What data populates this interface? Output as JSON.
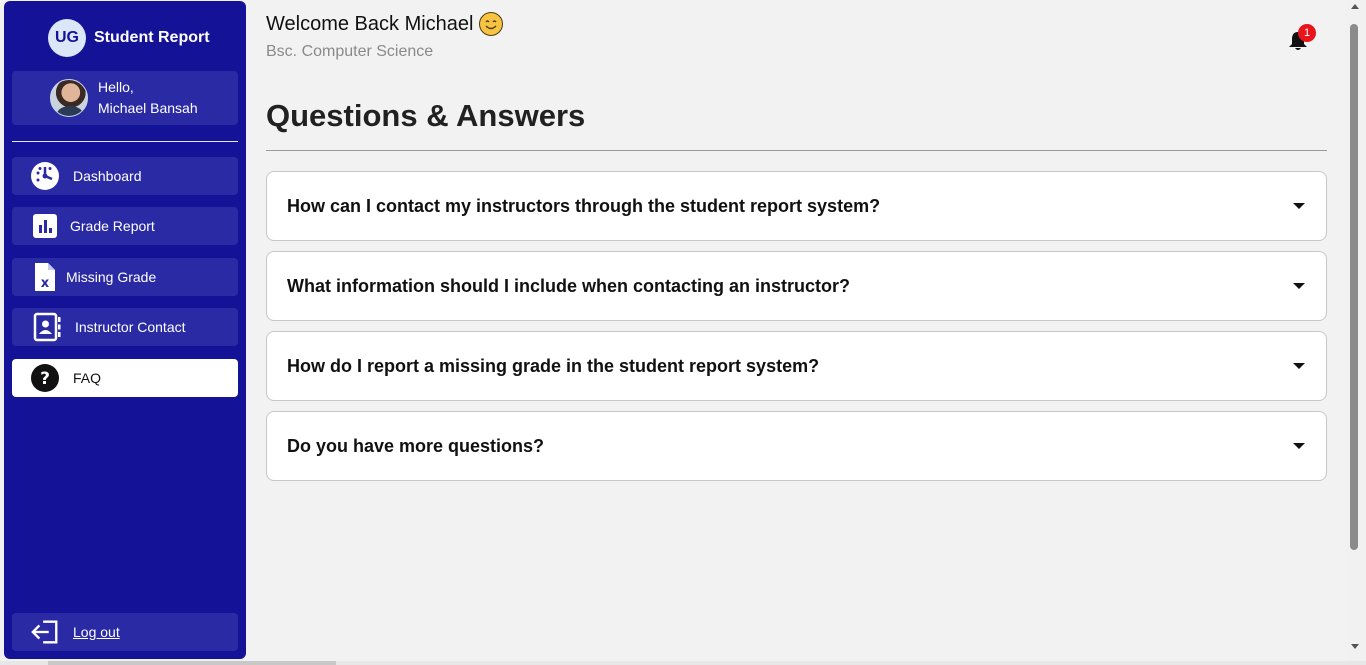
{
  "brand": {
    "badge": "UG",
    "name": "Student Report"
  },
  "user": {
    "greeting": "Hello,",
    "name": "Michael Bansah"
  },
  "nav": [
    {
      "label": "Dashboard",
      "icon": "dashboard-gauge-icon"
    },
    {
      "label": "Grade Report",
      "icon": "bar-chart-icon"
    },
    {
      "label": "Missing Grade",
      "icon": "file-x-icon"
    },
    {
      "label": "Instructor Contact",
      "icon": "contact-book-icon"
    },
    {
      "label": "FAQ",
      "icon": "question-circle-icon",
      "active": true
    }
  ],
  "logout": {
    "label": "Log out",
    "icon": "logout-arrow-icon"
  },
  "header": {
    "welcome": "Welcome Back Michael",
    "program": "Bsc. Computer Science",
    "notifications_count": "1"
  },
  "page_title": "Questions & Answers",
  "faqs": [
    "How can I contact my instructors through the student report system?",
    "What information should I include when contacting an instructor?",
    "How do I report a missing grade in the student report system?",
    "Do you have more questions?"
  ],
  "colors": {
    "sidebar": "#141296",
    "nav_item": "#2a2aa4",
    "badge": "#e8141c"
  }
}
